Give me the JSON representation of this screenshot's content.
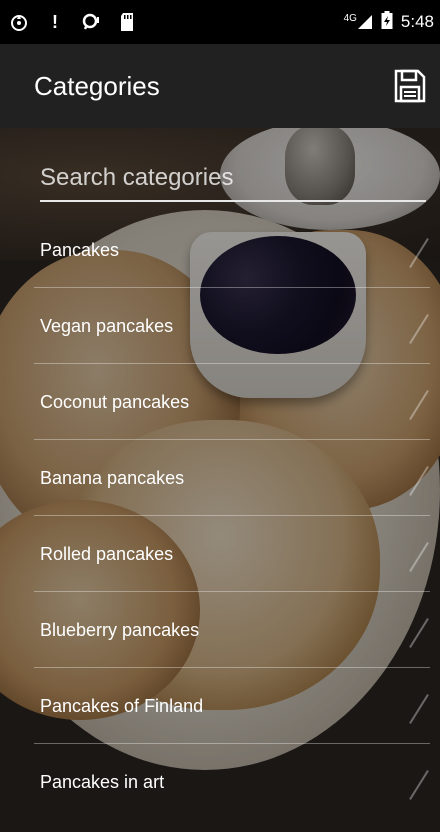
{
  "status_bar": {
    "icons": [
      "fire-icon",
      "alert-icon",
      "chat-icon",
      "sd-card-icon"
    ],
    "network": "4G",
    "time": "5:48"
  },
  "toolbar": {
    "title": "Categories",
    "save_icon": "floppy-disk-icon"
  },
  "search": {
    "placeholder": "Search categories"
  },
  "categories": [
    {
      "label": "Pancakes"
    },
    {
      "label": "Vegan pancakes"
    },
    {
      "label": "Coconut pancakes"
    },
    {
      "label": "Banana pancakes"
    },
    {
      "label": "Rolled pancakes"
    },
    {
      "label": "Blueberry pancakes"
    },
    {
      "label": "Pancakes of Finland"
    },
    {
      "label": "Pancakes in art"
    }
  ]
}
